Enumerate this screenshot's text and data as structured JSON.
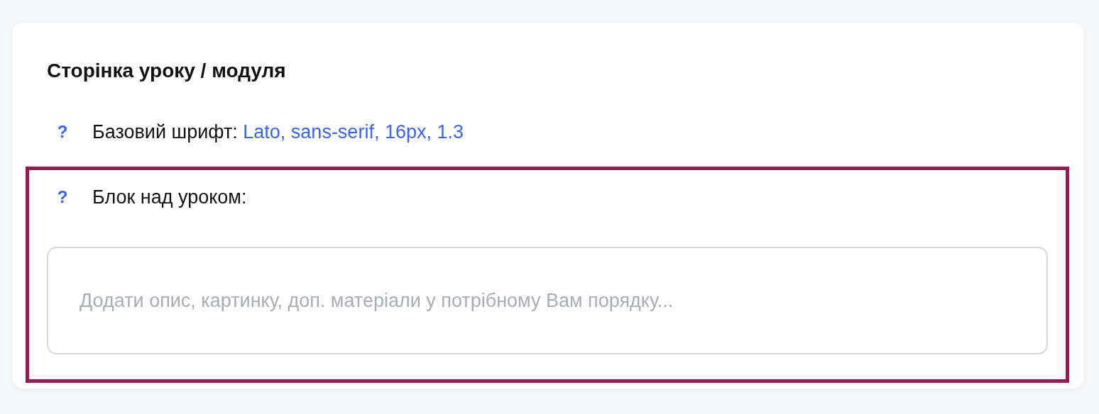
{
  "section": {
    "title": "Сторінка уроку / модуля"
  },
  "settings": [
    {
      "kind": "text",
      "help": "?",
      "label": "Базовий шрифт:",
      "value": "Lato, sans-serif, 16px, 1.3",
      "highlighted": false
    },
    {
      "kind": "editor",
      "help": "?",
      "label": "Блок над уроком:",
      "placeholder": "Додати опис, картинку, доп. матеріали у потрібному Вам порядку...",
      "highlighted": true
    }
  ]
}
